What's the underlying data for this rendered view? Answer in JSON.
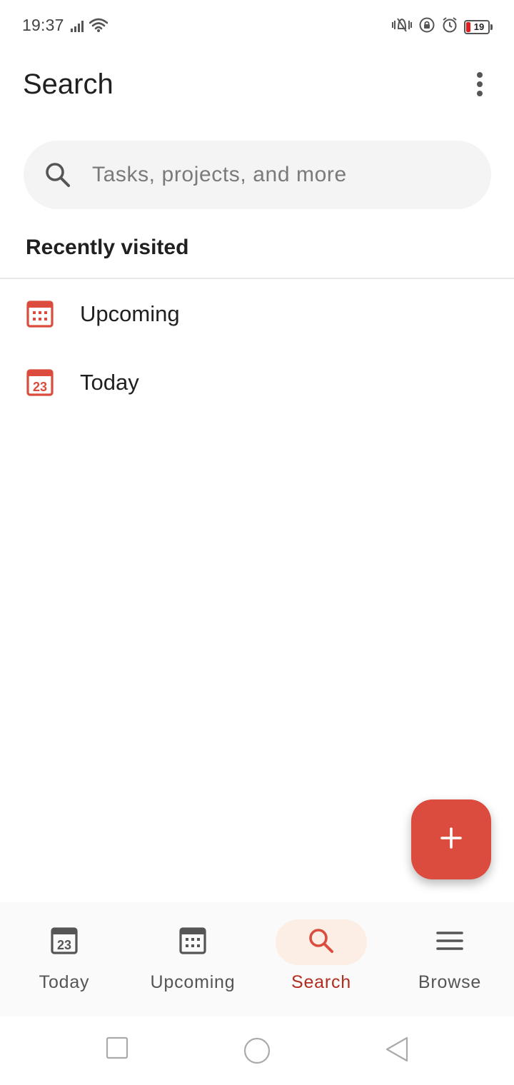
{
  "status_bar": {
    "time": "19:37",
    "battery": "19",
    "battery_color": "#e61b1b"
  },
  "header": {
    "title": "Search",
    "more_icon": "more-vertical-icon"
  },
  "search": {
    "placeholder": "Tasks, projects, and more",
    "icon": "search-icon"
  },
  "recent": {
    "heading": "Recently visited",
    "items": [
      {
        "label": "Upcoming",
        "icon": "calendar-grid-icon"
      },
      {
        "label": "Today",
        "icon": "calendar-today-icon",
        "icon_text": "23"
      }
    ]
  },
  "fab": {
    "icon": "plus-icon",
    "color": "#dc4c3e"
  },
  "tabs": [
    {
      "label": "Today",
      "icon": "calendar-today-icon",
      "icon_text": "23",
      "active": false
    },
    {
      "label": "Upcoming",
      "icon": "calendar-grid-icon",
      "active": false
    },
    {
      "label": "Search",
      "icon": "search-icon",
      "active": true
    },
    {
      "label": "Browse",
      "icon": "menu-icon",
      "active": false
    }
  ],
  "colors": {
    "accent": "#dc4c3e",
    "active_tab_text": "#b22d1f",
    "active_tab_pill": "#fdeee5"
  },
  "system_nav": {
    "recents_icon": "square-icon",
    "home_icon": "circle-icon",
    "back_icon": "triangle-back-icon"
  }
}
